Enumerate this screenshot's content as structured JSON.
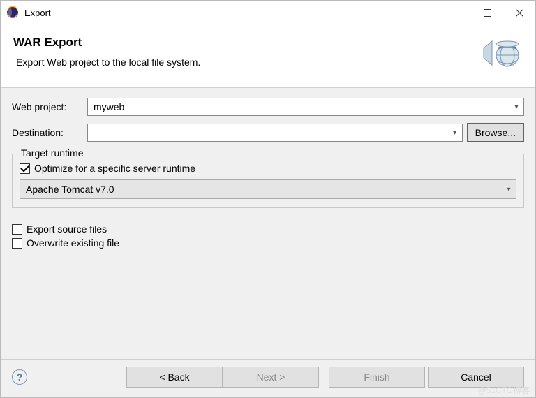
{
  "window": {
    "title": "Export"
  },
  "header": {
    "title": "WAR Export",
    "description": "Export Web project to the local file system."
  },
  "form": {
    "web_project_label": "Web project:",
    "web_project_value": "myweb",
    "destination_label": "Destination:",
    "destination_value": "",
    "browse_label": "Browse..."
  },
  "target_runtime": {
    "legend": "Target runtime",
    "optimize_label": "Optimize for a specific server runtime",
    "optimize_checked": true,
    "selected_runtime": "Apache Tomcat v7.0"
  },
  "options": {
    "export_source_label": "Export source files",
    "export_source_checked": false,
    "overwrite_label": "Overwrite existing file",
    "overwrite_checked": false
  },
  "buttons": {
    "back": "< Back",
    "next": "Next >",
    "finish": "Finish",
    "cancel": "Cancel"
  },
  "watermark": "@51CTO博客"
}
